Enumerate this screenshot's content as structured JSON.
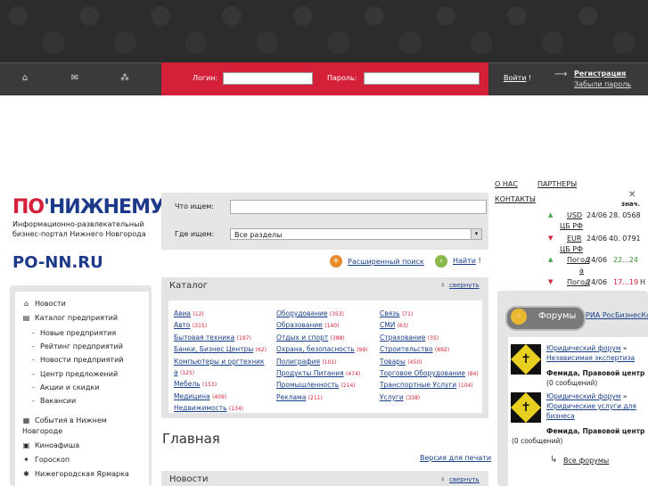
{
  "header": {
    "icons": [
      "home-icon",
      "mail-icon",
      "sitemap-icon"
    ],
    "login_label": "Логин:",
    "password_label": "Пароль:",
    "login_button": "Войти",
    "login_suffix": "!",
    "arrow": "⟶",
    "register": "Регистрация",
    "forgot_password": "Забыли пароль"
  },
  "brand": {
    "logo_left": "ПО",
    "logo_right": "НИЖНЕМУ",
    "tagline": "Информационно-развлекательный бизнес-портал Нижнего Новгорода",
    "site": "PO-NN.RU"
  },
  "search": {
    "what_label": "Что ищем:",
    "where_label": "Где ищем:",
    "where_value": "Все разделы",
    "advanced": "Расширенный поиск",
    "find": "Найти",
    "find_suffix": "!"
  },
  "catalog": {
    "title": "Каталог",
    "collapse": "свернуть",
    "columns": [
      [
        {
          "name": "Авиа",
          "count": "(12)"
        },
        {
          "name": "Авто",
          "count": "(315)"
        },
        {
          "name": "Бытовая техника",
          "count": "(197)"
        },
        {
          "name": "Банки, Бизнес Центры",
          "count": "(62)"
        },
        {
          "name": "Компьютеры и оргтехник",
          "count": ""
        },
        {
          "name": "а",
          "count": "(125)"
        },
        {
          "name": "Мебель",
          "count": "(153)"
        },
        {
          "name": "Медицина",
          "count": "(409)"
        },
        {
          "name": "Недвижимость",
          "count": "(134)"
        }
      ],
      [
        {
          "name": "Оборудование",
          "count": "(353)"
        },
        {
          "name": "Образование",
          "count": "(140)"
        },
        {
          "name": "Отдых и спорт",
          "count": "(388)"
        },
        {
          "name": "Охрана, безопасность",
          "count": "(99)"
        },
        {
          "name": "Полиграфия",
          "count": "(101)"
        },
        {
          "name": "Продукты Питания",
          "count": "(474)"
        },
        {
          "name": "Промышленность",
          "count": "(214)"
        },
        {
          "name": "Реклама",
          "count": "(211)"
        }
      ],
      [
        {
          "name": "Связь",
          "count": "(71)"
        },
        {
          "name": "СМИ",
          "count": "(63)"
        },
        {
          "name": "Страхование",
          "count": "(35)"
        },
        {
          "name": "Строительство",
          "count": "(892)"
        },
        {
          "name": "Товары",
          "count": "(450)"
        },
        {
          "name": "Торговое Оборудование",
          "count": "(84)"
        },
        {
          "name": "Транспортные Услуги",
          "count": "(104)"
        },
        {
          "name": "Услуги",
          "count": "(338)"
        }
      ]
    ]
  },
  "main": {
    "title": "Главная",
    "print": "Версия для печати",
    "news_title": "Новости",
    "news_collapse": "свернуть"
  },
  "sidebar": {
    "items": [
      {
        "label": "Новости",
        "icon": "home-icon",
        "glyph": "⌂"
      },
      {
        "label": "Каталог предприятий",
        "icon": "catalog-icon",
        "glyph": "▤"
      }
    ],
    "sub_items": [
      "Новые предприятия",
      "Рейтинг предприятий",
      "Новости предприятий",
      "Центр предложений",
      "Акции и скидки",
      "Вакансии"
    ],
    "bottom_items": [
      {
        "label": "События в Нижнем",
        "label2": "Новгороде",
        "icon": "events-icon",
        "glyph": "▦"
      },
      {
        "label": "Киноафиша",
        "icon": "film-icon",
        "glyph": "▣"
      },
      {
        "label": "Гороскоп",
        "icon": "horoscope-icon",
        "glyph": "✦"
      },
      {
        "label": "Нижегородская Ярмарка",
        "icon": "fair-icon",
        "glyph": "✱"
      }
    ]
  },
  "right": {
    "about": "О НАС",
    "partners": "ПАРТНЕРЫ",
    "contacts": "КОНТАКТЫ",
    "close": "✕",
    "zn": "знач.",
    "rates": [
      {
        "dir": "up",
        "name": "USD",
        "date": "24/06",
        "value": "28. 0568",
        "src": "ЦБ РФ"
      },
      {
        "dir": "down",
        "name": "EUR",
        "date": "24/06",
        "value": "40. 0791",
        "src": "ЦБ РФ"
      }
    ],
    "weather": [
      {
        "dir": "up",
        "name": "Погод",
        "date": "24/06",
        "value": "22...24",
        "tail": "а"
      },
      {
        "dir": "down",
        "name": "Погод",
        "date": "24/06",
        "value": "17...19",
        "extra": "Н",
        "tail": "а"
      }
    ]
  },
  "forums": {
    "title": "Форумы",
    "ria": "РИА РосБизнесКо",
    "entries": [
      {
        "line1": "Юридический форум",
        "line1_suffix": "»",
        "line2": "Независимая экспертиза",
        "author": "Фемида, Правовой центр",
        "messages": "(0 сообщений)"
      },
      {
        "line1": "Юридический форум",
        "line1_suffix": "»",
        "line2": "Юридические услуги для",
        "line3": "бизнеса",
        "author": "Фемида, Правовой центр",
        "messages": "(0 сообщений)"
      }
    ],
    "all": "Все форумы",
    "all_arrow": "↳"
  },
  "colors": {
    "red": "#d42038",
    "blue": "#1d3a8a",
    "dark": "#2c2c2c"
  }
}
